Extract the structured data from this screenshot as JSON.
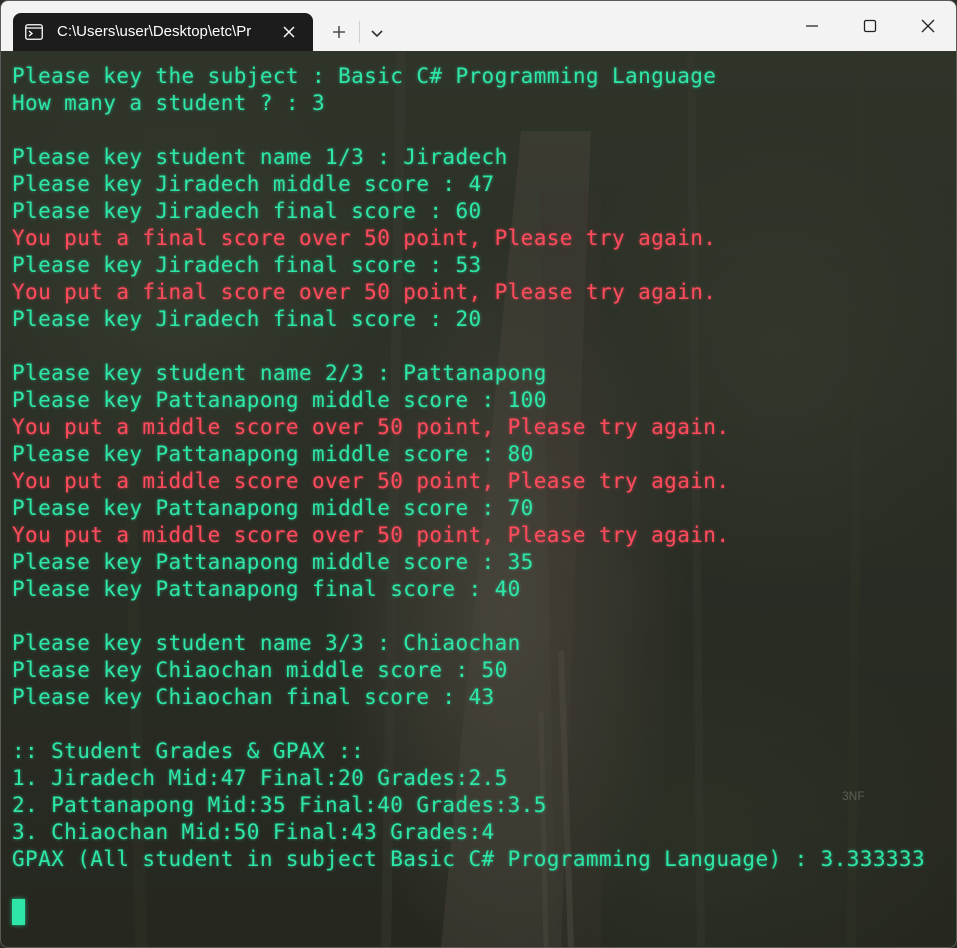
{
  "window": {
    "tab_title": "C:\\Users\\user\\Desktop\\etc\\Pr",
    "tab_icon": "terminal-icon",
    "buttons": {
      "new_tab_icon": "plus-icon",
      "dropdown_icon": "chevron-down-icon",
      "minimize_icon": "minimize-icon",
      "maximize_icon": "maximize-icon",
      "close_icon": "close-icon"
    }
  },
  "colors": {
    "output_text": "#2ee6a8",
    "error_text": "#ff4b5c",
    "titlebar": "#f3f3f3",
    "active_tab": "#1c1c1c"
  },
  "terminal": {
    "lines": [
      {
        "text": "Please key the subject : Basic C# Programming Language",
        "kind": "out"
      },
      {
        "text": "How many a student ? : 3",
        "kind": "out"
      },
      {
        "text": "",
        "kind": "out"
      },
      {
        "text": "Please key student name 1/3 : Jiradech",
        "kind": "out"
      },
      {
        "text": "Please key Jiradech middle score : 47",
        "kind": "out"
      },
      {
        "text": "Please key Jiradech final score : 60",
        "kind": "out"
      },
      {
        "text": "You put a final score over 50 point, Please try again.",
        "kind": "err"
      },
      {
        "text": "Please key Jiradech final score : 53",
        "kind": "out"
      },
      {
        "text": "You put a final score over 50 point, Please try again.",
        "kind": "err"
      },
      {
        "text": "Please key Jiradech final score : 20",
        "kind": "out"
      },
      {
        "text": "",
        "kind": "out"
      },
      {
        "text": "Please key student name 2/3 : Pattanapong",
        "kind": "out"
      },
      {
        "text": "Please key Pattanapong middle score : 100",
        "kind": "out"
      },
      {
        "text": "You put a middle score over 50 point, Please try again.",
        "kind": "err"
      },
      {
        "text": "Please key Pattanapong middle score : 80",
        "kind": "out"
      },
      {
        "text": "You put a middle score over 50 point, Please try again.",
        "kind": "err"
      },
      {
        "text": "Please key Pattanapong middle score : 70",
        "kind": "out"
      },
      {
        "text": "You put a middle score over 50 point, Please try again.",
        "kind": "err"
      },
      {
        "text": "Please key Pattanapong middle score : 35",
        "kind": "out"
      },
      {
        "text": "Please key Pattanapong final score : 40",
        "kind": "out"
      },
      {
        "text": "",
        "kind": "out"
      },
      {
        "text": "Please key student name 3/3 : Chiaochan",
        "kind": "out"
      },
      {
        "text": "Please key Chiaochan middle score : 50",
        "kind": "out"
      },
      {
        "text": "Please key Chiaochan final score : 43",
        "kind": "out"
      },
      {
        "text": "",
        "kind": "out"
      },
      {
        "text": ":: Student Grades & GPAX ::",
        "kind": "out"
      },
      {
        "text": "1. Jiradech Mid:47 Final:20 Grades:2.5",
        "kind": "out"
      },
      {
        "text": "2. Pattanapong Mid:35 Final:40 Grades:3.5",
        "kind": "out"
      },
      {
        "text": "3. Chiaochan Mid:50 Final:43 Grades:4",
        "kind": "out"
      },
      {
        "text": "GPAX (All student in subject Basic C# Programming Language) : 3.333333",
        "kind": "out"
      }
    ],
    "watermark": "3NF"
  }
}
